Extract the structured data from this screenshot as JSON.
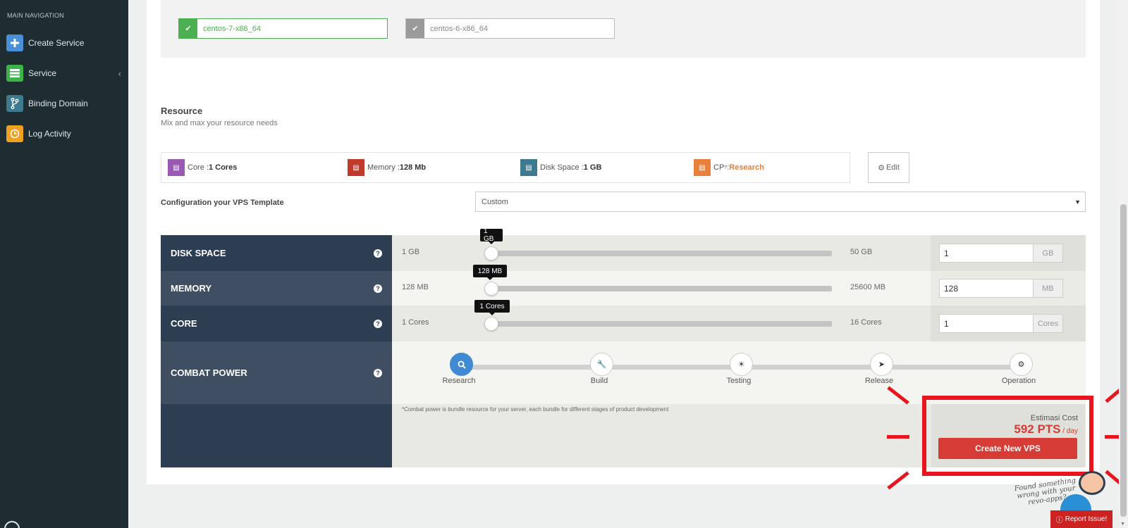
{
  "sidebar": {
    "header": "MAIN NAVIGATION",
    "items": [
      {
        "label": "Create Service",
        "icon": "plus-icon",
        "color": "#4a90d9"
      },
      {
        "label": "Service",
        "icon": "server-icon",
        "color": "#3cb44a"
      },
      {
        "label": "Binding Domain",
        "icon": "branch-icon",
        "color": "#3d7a8f"
      },
      {
        "label": "Log Activity",
        "icon": "clock-icon",
        "color": "#f0a020"
      }
    ]
  },
  "os": {
    "selected": "centos-7-x86_64",
    "other": "centos-6-x86_64"
  },
  "resource": {
    "title": "Resource",
    "subtitle": "Mix and max your resource needs"
  },
  "summary": {
    "core_label": "Core : ",
    "core_value": "1 Cores",
    "memory_label": "Memory : ",
    "memory_value": "128 Mb",
    "disk_label": "Disk Space : ",
    "disk_value": "1 GB",
    "cp_label": "CP ",
    "cp_sup": "?",
    "cp_colon": ": ",
    "cp_value": "Research",
    "edit_label": "Edit"
  },
  "template": {
    "label": "Configuration your VPS Template",
    "selected": "Custom"
  },
  "sliders": {
    "disk": {
      "label": "DISK SPACE",
      "min": "1 GB",
      "max": "50 GB",
      "tip": "1 GB",
      "value": "1",
      "unit": "GB"
    },
    "memory": {
      "label": "MEMORY",
      "min": "128 MB",
      "max": "25600 MB",
      "tip": "128 MB",
      "value": "128",
      "unit": "MB"
    },
    "core": {
      "label": "CORE",
      "min": "1 Cores",
      "max": "16 Cores",
      "tip": "1 Cores",
      "value": "1",
      "unit": "Cores"
    }
  },
  "combat": {
    "label": "COMBAT POWER",
    "stages": [
      "Research",
      "Build",
      "Testing",
      "Release",
      "Operation"
    ],
    "active": "Research",
    "note": "*Combat power is bundle resource for your server, each bundle for different stages of product development"
  },
  "cost": {
    "label": "Estimasi Cost",
    "value": "592 PTS",
    "per": " / day",
    "button": "Create New VPS"
  },
  "help": {
    "note_line1": "Found something",
    "note_line2": "wrong with your",
    "note_line3": "revo-apps?",
    "report": "Report Issue!"
  },
  "colors": {
    "accent_red": "#d63b35",
    "highlight_red": "#e8141e",
    "sidebar_bg": "#1d2d32",
    "table_dark": "#2d3e52",
    "table_dark_alt": "#3f4e61",
    "selected_green": "#4cb050",
    "active_stage_blue": "#3f8ad2",
    "cp_orange": "#e8813c"
  }
}
